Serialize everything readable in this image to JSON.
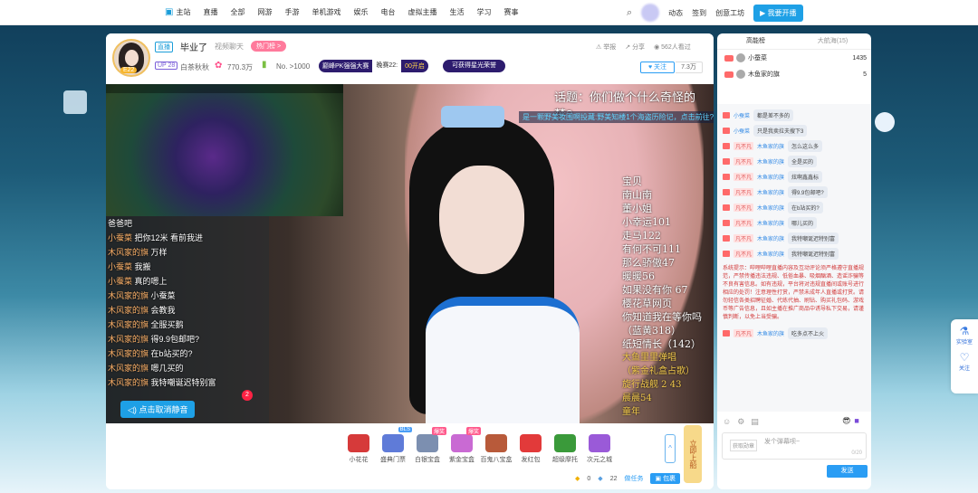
{
  "nav": {
    "items": [
      "主站",
      "直播",
      "全部",
      "网游",
      "手游",
      "单机游戏",
      "娱乐",
      "电台",
      "虚拟主播",
      "生活",
      "学习",
      "赛事"
    ],
    "right": [
      "动态",
      "签到",
      "创意工坊"
    ],
    "open_live": "我要开播"
  },
  "anchor": {
    "live_tag": "直播",
    "title": "毕业了",
    "category": "视频聊天",
    "hot_tag": "热门榜 >",
    "level_badge": "E22",
    "up_level": "UP 28",
    "name": "白茶秋秋",
    "fans": "770.3万",
    "rank": "No. >1000",
    "pk_a": "巅峰PK强强大赛",
    "pk_b": "晚赛22:",
    "pk_c": "00开启",
    "star_pill": "可获得星光荣誉",
    "report": "举报",
    "share": "分享",
    "viewers": "562人看过",
    "follow": "关注",
    "follow_count": "7.3万"
  },
  "video": {
    "topic": "话题：你们做个什么奇怪的梦?",
    "ticker": "是一颗野美妆围啊投藏:野美知楼1个海盗历险记，点击前往?",
    "left_lines": [
      {
        "n": "",
        "t": "爸爸吧"
      },
      {
        "n": "小蚕菜",
        "t": "把你12米 看前我进"
      },
      {
        "n": "木风家的旗",
        "t": "万样"
      },
      {
        "n": "小蚕菜",
        "t": "我搬"
      },
      {
        "n": "小蚕菜",
        "t": "真的嗯上"
      },
      {
        "n": "木风家的旗",
        "t": "小蚕菜"
      },
      {
        "n": "木风家的旗",
        "t": "会教我"
      },
      {
        "n": "木风家的旗",
        "t": "全服买鹅"
      },
      {
        "n": "木风家的旗",
        "t": "得9.9包邮吧?"
      },
      {
        "n": "木风家的旗",
        "t": "在b站买的?"
      },
      {
        "n": "木风家的旗",
        "t": "嗯几买的"
      },
      {
        "n": "木风家的旗",
        "t": "我特嘲诞迟特别富"
      }
    ],
    "right_lines": [
      "宝贝",
      "南山南",
      "董小姐",
      "小幸运101",
      "走马122",
      "有何不可111",
      "那么骄傲47",
      "暖暖56",
      "如果没有你 67",
      "樱花草网页",
      "你知道我在等你吗",
      "（蓝黄318）",
      "纸短情长（142）"
    ],
    "right_gold": [
      "大鱼里里弹唱",
      "（紫金礼盒占歌）",
      "旋行战舰 2 43",
      "晨晨54",
      "童年"
    ],
    "unmute": "点击取消静音",
    "badge_num": "2"
  },
  "gifts": [
    {
      "label": "小花花",
      "tag": "",
      "color": "#d63a3a"
    },
    {
      "label": "盛典门票",
      "tag": "BLS",
      "color": "#5f7bd8"
    },
    {
      "label": "白银宝盒",
      "tag": "爆奖",
      "color": "#7c8fb0"
    },
    {
      "label": "紫金宝盒",
      "tag": "爆奖",
      "color": "#c96ad3"
    },
    {
      "label": "百鬼八宝盒",
      "tag": "",
      "color": "#b85a3a"
    },
    {
      "label": "发红包",
      "tag": "",
      "color": "#e23a3a"
    },
    {
      "label": "超级摩托",
      "tag": "",
      "color": "#3a9a3a"
    },
    {
      "label": "次元之城",
      "tag": "",
      "color": "#9a5ad8"
    }
  ],
  "giftbar": {
    "up_arrow": "^",
    "cheer": "立即上船",
    "gold": "0",
    "silver": "22",
    "task": "做任务",
    "package": "包裹"
  },
  "side": {
    "tabs": [
      "高能榜",
      "大航海(15)"
    ],
    "ranking": [
      {
        "name": "小蚕菜",
        "value": "1435"
      },
      {
        "name": "木鱼家的旗",
        "value": "5"
      }
    ],
    "messages": [
      {
        "badge": "",
        "name": "小蚕菜",
        "text": "都是差不多的"
      },
      {
        "badge": "",
        "name": "小蚕菜",
        "text": "只是我卖拉夫搜下3"
      },
      {
        "badge": "凡不凡",
        "name": "木鱼家的旗",
        "text": "怎么这么多"
      },
      {
        "badge": "凡不凡",
        "name": "木鱼家的旗",
        "text": "全是买的"
      },
      {
        "badge": "凡不凡",
        "name": "木鱼家的旗",
        "text": "炫啊鑫鑫标"
      },
      {
        "badge": "凡不凡",
        "name": "木鱼家的旗",
        "text": "得9.9包邮吧?"
      },
      {
        "badge": "凡不凡",
        "name": "木鱼家的旗",
        "text": "在b站买的?"
      },
      {
        "badge": "凡不凡",
        "name": "木鱼家的旗",
        "text": "哪儿买的"
      },
      {
        "badge": "凡不凡",
        "name": "木鱼家的旗",
        "text": "我特嘲诞迟特别富"
      },
      {
        "badge": "凡不凡",
        "name": "木鱼家的旗",
        "text": "我特嘲诞迟特别富"
      }
    ],
    "system": "系统提示：哔哩哔哩直播内容及互动评论须严格遵守直播规范，严禁传播违法违规、低俗血暴、吸烟酗酒、造谣诈骗等不良有害信息。如有违规，平台将对违规直播间或账号进行相应的处罚！注意理性打赏，严禁未成年人直播或打赏。请勿轻信各类招聘征婚、代练代抽、刷钻、购买礼包码、游戏币等广告信息，且如主播在推广商品中诱导私下交易，请谨慎判断，以免上当受骗。",
    "last_msg": {
      "badge": "凡不凡",
      "name": "木鱼家的旗",
      "text": "吃多点不上火"
    },
    "medal": "获取勋章",
    "placeholder": "发个弹幕呗~",
    "counter": "0/20",
    "send": "发送"
  },
  "floating": {
    "lab": "实验室",
    "follow": "关注"
  }
}
